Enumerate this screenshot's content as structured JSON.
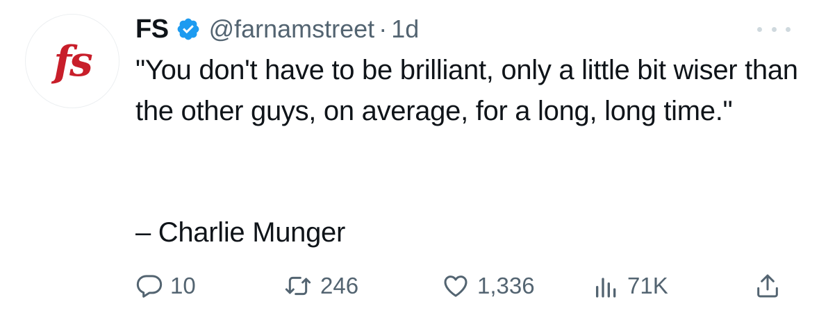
{
  "author": {
    "avatar_text": "fs",
    "display_name": "FS",
    "handle": "@farnamstreet",
    "separator": "·",
    "time": "1d",
    "verified": true,
    "verified_color": "#1d9bf0",
    "avatar_text_color": "#c81e2a"
  },
  "tweet": {
    "text": "\"You don't have to be brilliant, only a little bit wiser than the other guys, on average, for a long, long time.\"",
    "attribution": "– Charlie Munger"
  },
  "actions": {
    "reply": {
      "icon": "reply-icon",
      "count": "10"
    },
    "retweet": {
      "icon": "retweet-icon",
      "count": "246"
    },
    "like": {
      "icon": "heart-icon",
      "count": "1,336"
    },
    "views": {
      "icon": "views-icon",
      "count": "71K"
    },
    "share": {
      "icon": "share-icon"
    }
  },
  "colors": {
    "text_primary": "#0f1419",
    "text_secondary": "#536471",
    "more_dots": "#cfd9de"
  }
}
